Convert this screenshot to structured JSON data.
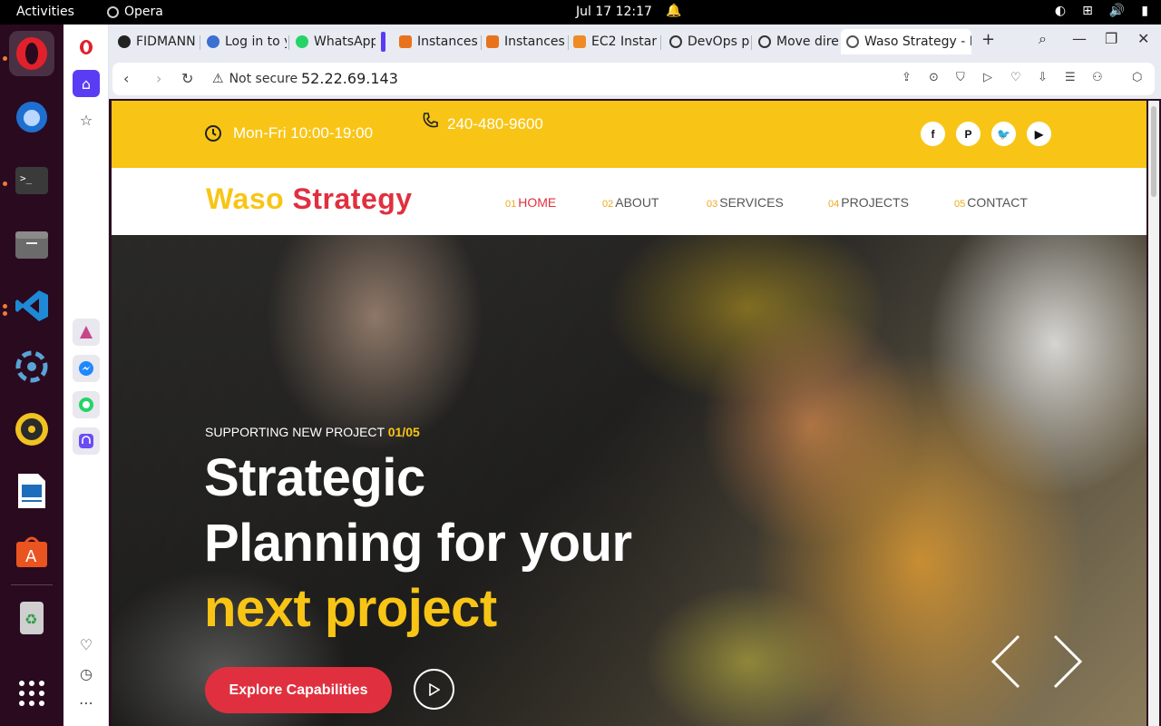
{
  "system": {
    "activities": "Activities",
    "app_name": "Opera",
    "clock": "Jul 17  12:17"
  },
  "tabs": [
    {
      "label": "FIDMANN",
      "icon": "github-icon"
    },
    {
      "label": "Log in to y",
      "icon": "login-icon"
    },
    {
      "label": "WhatsApp",
      "icon": "whatsapp-icon"
    },
    {
      "label": "Instances",
      "icon": "aws-icon"
    },
    {
      "label": "Instances",
      "icon": "aws-icon"
    },
    {
      "label": "EC2 Instar",
      "icon": "aws-cube-icon"
    },
    {
      "label": "DevOps p",
      "icon": "openai-icon"
    },
    {
      "label": "Move dire",
      "icon": "openai-icon"
    },
    {
      "label": "Waso Strategy - E",
      "icon": "globe-icon"
    }
  ],
  "address": {
    "security": "Not secure",
    "url": "52.22.69.143"
  },
  "site": {
    "hours": "Mon-Fri 10:00-19:00",
    "phone": "240-480-9600",
    "socials": [
      "facebook",
      "pinterest",
      "twitter",
      "youtube"
    ],
    "logo_part1": "Waso",
    "logo_part2": "Strategy",
    "menu": [
      {
        "num": "01",
        "label": "HOME",
        "active": true
      },
      {
        "num": "02",
        "label": "ABOUT"
      },
      {
        "num": "03",
        "label": "SERVICES"
      },
      {
        "num": "04",
        "label": "PROJECTS"
      },
      {
        "num": "05",
        "label": "CONTACT"
      }
    ],
    "hero": {
      "eyebrow": "SUPPORTING NEW PROJECT",
      "count": "01/05",
      "line1": "Strategic",
      "line2": "Planning for your",
      "line3": "next project",
      "cta": "Explore Capabilities"
    }
  },
  "colors": {
    "brand_yellow": "#f8c516",
    "brand_red": "#e0303f",
    "opera_accent": "#5b3cf5"
  }
}
